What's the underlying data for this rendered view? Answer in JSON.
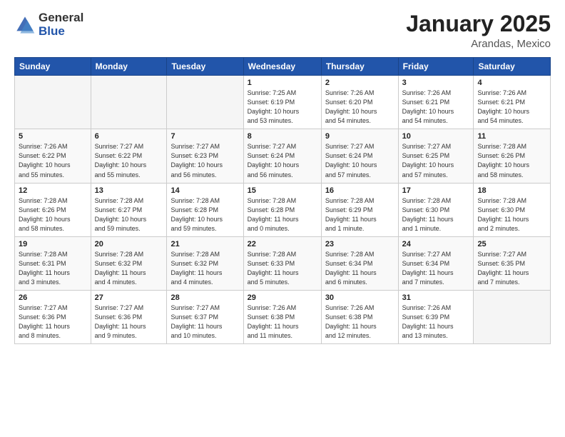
{
  "logo": {
    "general": "General",
    "blue": "Blue"
  },
  "header": {
    "title": "January 2025",
    "subtitle": "Arandas, Mexico"
  },
  "weekdays": [
    "Sunday",
    "Monday",
    "Tuesday",
    "Wednesday",
    "Thursday",
    "Friday",
    "Saturday"
  ],
  "weeks": [
    [
      {
        "day": "",
        "info": ""
      },
      {
        "day": "",
        "info": ""
      },
      {
        "day": "",
        "info": ""
      },
      {
        "day": "1",
        "info": "Sunrise: 7:25 AM\nSunset: 6:19 PM\nDaylight: 10 hours\nand 53 minutes."
      },
      {
        "day": "2",
        "info": "Sunrise: 7:26 AM\nSunset: 6:20 PM\nDaylight: 10 hours\nand 54 minutes."
      },
      {
        "day": "3",
        "info": "Sunrise: 7:26 AM\nSunset: 6:21 PM\nDaylight: 10 hours\nand 54 minutes."
      },
      {
        "day": "4",
        "info": "Sunrise: 7:26 AM\nSunset: 6:21 PM\nDaylight: 10 hours\nand 54 minutes."
      }
    ],
    [
      {
        "day": "5",
        "info": "Sunrise: 7:26 AM\nSunset: 6:22 PM\nDaylight: 10 hours\nand 55 minutes."
      },
      {
        "day": "6",
        "info": "Sunrise: 7:27 AM\nSunset: 6:22 PM\nDaylight: 10 hours\nand 55 minutes."
      },
      {
        "day": "7",
        "info": "Sunrise: 7:27 AM\nSunset: 6:23 PM\nDaylight: 10 hours\nand 56 minutes."
      },
      {
        "day": "8",
        "info": "Sunrise: 7:27 AM\nSunset: 6:24 PM\nDaylight: 10 hours\nand 56 minutes."
      },
      {
        "day": "9",
        "info": "Sunrise: 7:27 AM\nSunset: 6:24 PM\nDaylight: 10 hours\nand 57 minutes."
      },
      {
        "day": "10",
        "info": "Sunrise: 7:27 AM\nSunset: 6:25 PM\nDaylight: 10 hours\nand 57 minutes."
      },
      {
        "day": "11",
        "info": "Sunrise: 7:28 AM\nSunset: 6:26 PM\nDaylight: 10 hours\nand 58 minutes."
      }
    ],
    [
      {
        "day": "12",
        "info": "Sunrise: 7:28 AM\nSunset: 6:26 PM\nDaylight: 10 hours\nand 58 minutes."
      },
      {
        "day": "13",
        "info": "Sunrise: 7:28 AM\nSunset: 6:27 PM\nDaylight: 10 hours\nand 59 minutes."
      },
      {
        "day": "14",
        "info": "Sunrise: 7:28 AM\nSunset: 6:28 PM\nDaylight: 10 hours\nand 59 minutes."
      },
      {
        "day": "15",
        "info": "Sunrise: 7:28 AM\nSunset: 6:28 PM\nDaylight: 11 hours\nand 0 minutes."
      },
      {
        "day": "16",
        "info": "Sunrise: 7:28 AM\nSunset: 6:29 PM\nDaylight: 11 hours\nand 1 minute."
      },
      {
        "day": "17",
        "info": "Sunrise: 7:28 AM\nSunset: 6:30 PM\nDaylight: 11 hours\nand 1 minute."
      },
      {
        "day": "18",
        "info": "Sunrise: 7:28 AM\nSunset: 6:30 PM\nDaylight: 11 hours\nand 2 minutes."
      }
    ],
    [
      {
        "day": "19",
        "info": "Sunrise: 7:28 AM\nSunset: 6:31 PM\nDaylight: 11 hours\nand 3 minutes."
      },
      {
        "day": "20",
        "info": "Sunrise: 7:28 AM\nSunset: 6:32 PM\nDaylight: 11 hours\nand 4 minutes."
      },
      {
        "day": "21",
        "info": "Sunrise: 7:28 AM\nSunset: 6:32 PM\nDaylight: 11 hours\nand 4 minutes."
      },
      {
        "day": "22",
        "info": "Sunrise: 7:28 AM\nSunset: 6:33 PM\nDaylight: 11 hours\nand 5 minutes."
      },
      {
        "day": "23",
        "info": "Sunrise: 7:28 AM\nSunset: 6:34 PM\nDaylight: 11 hours\nand 6 minutes."
      },
      {
        "day": "24",
        "info": "Sunrise: 7:27 AM\nSunset: 6:34 PM\nDaylight: 11 hours\nand 7 minutes."
      },
      {
        "day": "25",
        "info": "Sunrise: 7:27 AM\nSunset: 6:35 PM\nDaylight: 11 hours\nand 7 minutes."
      }
    ],
    [
      {
        "day": "26",
        "info": "Sunrise: 7:27 AM\nSunset: 6:36 PM\nDaylight: 11 hours\nand 8 minutes."
      },
      {
        "day": "27",
        "info": "Sunrise: 7:27 AM\nSunset: 6:36 PM\nDaylight: 11 hours\nand 9 minutes."
      },
      {
        "day": "28",
        "info": "Sunrise: 7:27 AM\nSunset: 6:37 PM\nDaylight: 11 hours\nand 10 minutes."
      },
      {
        "day": "29",
        "info": "Sunrise: 7:26 AM\nSunset: 6:38 PM\nDaylight: 11 hours\nand 11 minutes."
      },
      {
        "day": "30",
        "info": "Sunrise: 7:26 AM\nSunset: 6:38 PM\nDaylight: 11 hours\nand 12 minutes."
      },
      {
        "day": "31",
        "info": "Sunrise: 7:26 AM\nSunset: 6:39 PM\nDaylight: 11 hours\nand 13 minutes."
      },
      {
        "day": "",
        "info": ""
      }
    ]
  ]
}
